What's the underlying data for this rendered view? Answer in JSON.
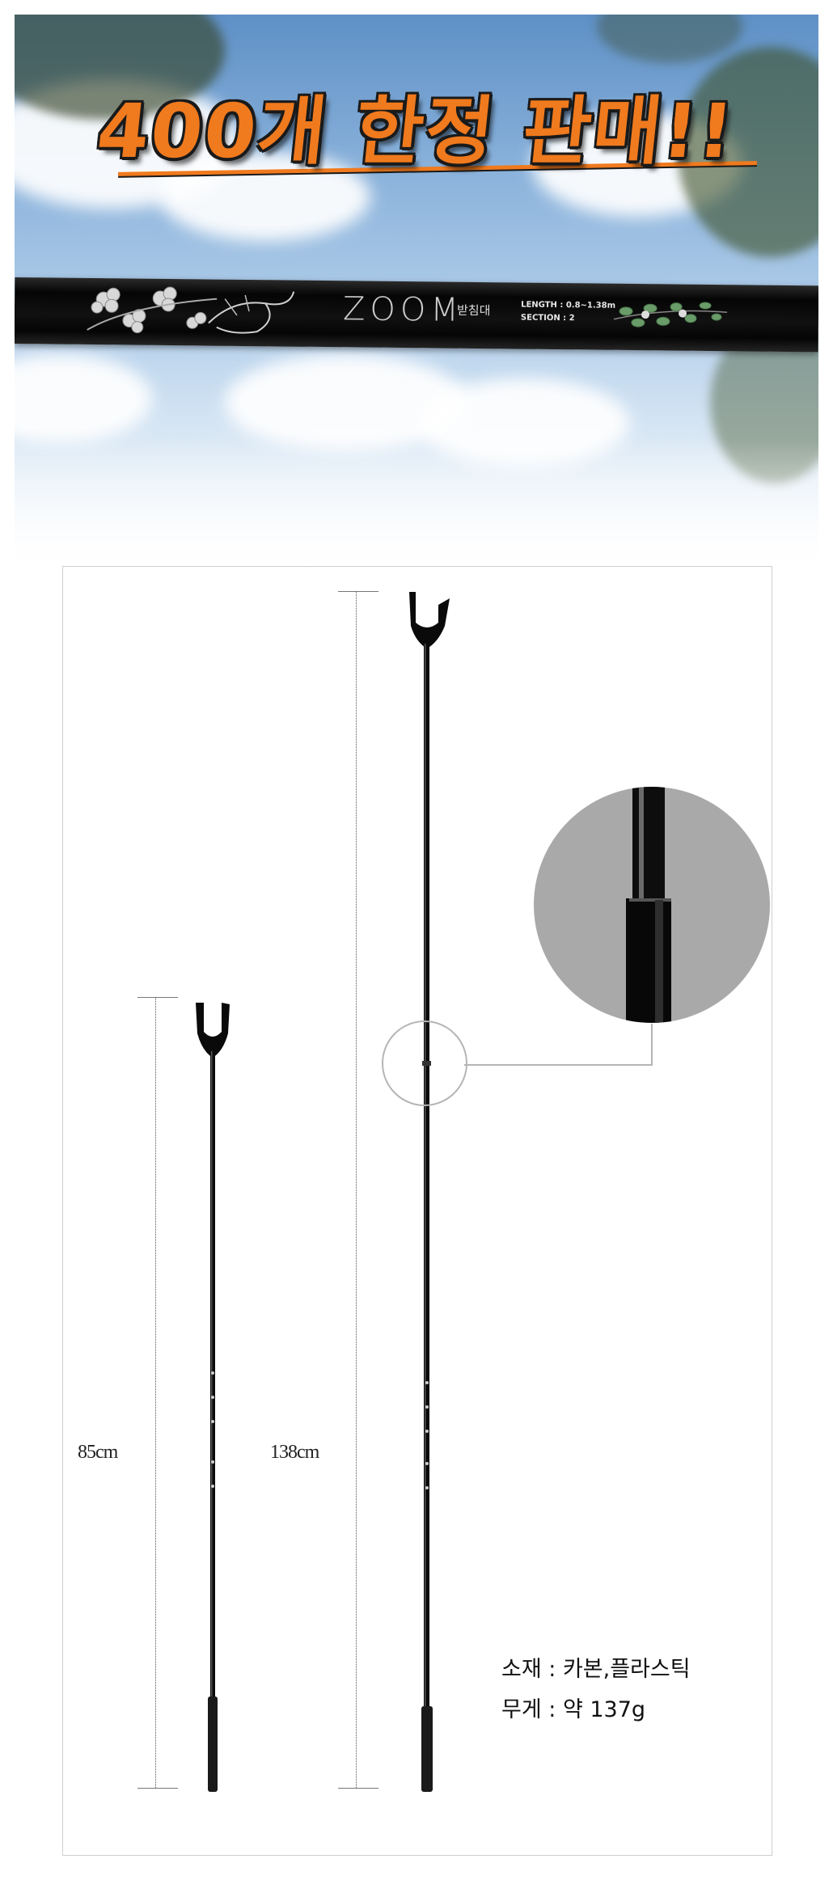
{
  "hero": {
    "headline": "400개 한정 판매!!",
    "banner": {
      "brand": "ZOOM",
      "subtitle": "받침대",
      "length": "LENGTH : 0.8~1.38m",
      "section": "SECTION : 2"
    }
  },
  "dimensions": {
    "short_length": "85cm",
    "long_length": "138cm"
  },
  "specs": {
    "material": "소재 : 카본,플라스틱",
    "weight": "무게 : 약 137g"
  },
  "colors": {
    "headline_orange": "#f07a1e",
    "rod_black": "#0a0a0a",
    "zoom_gray": "#a9a9a9"
  },
  "icons": [
    "flower-decoration-icon",
    "fish-illustration-icon",
    "leaf-decoration-icon"
  ]
}
